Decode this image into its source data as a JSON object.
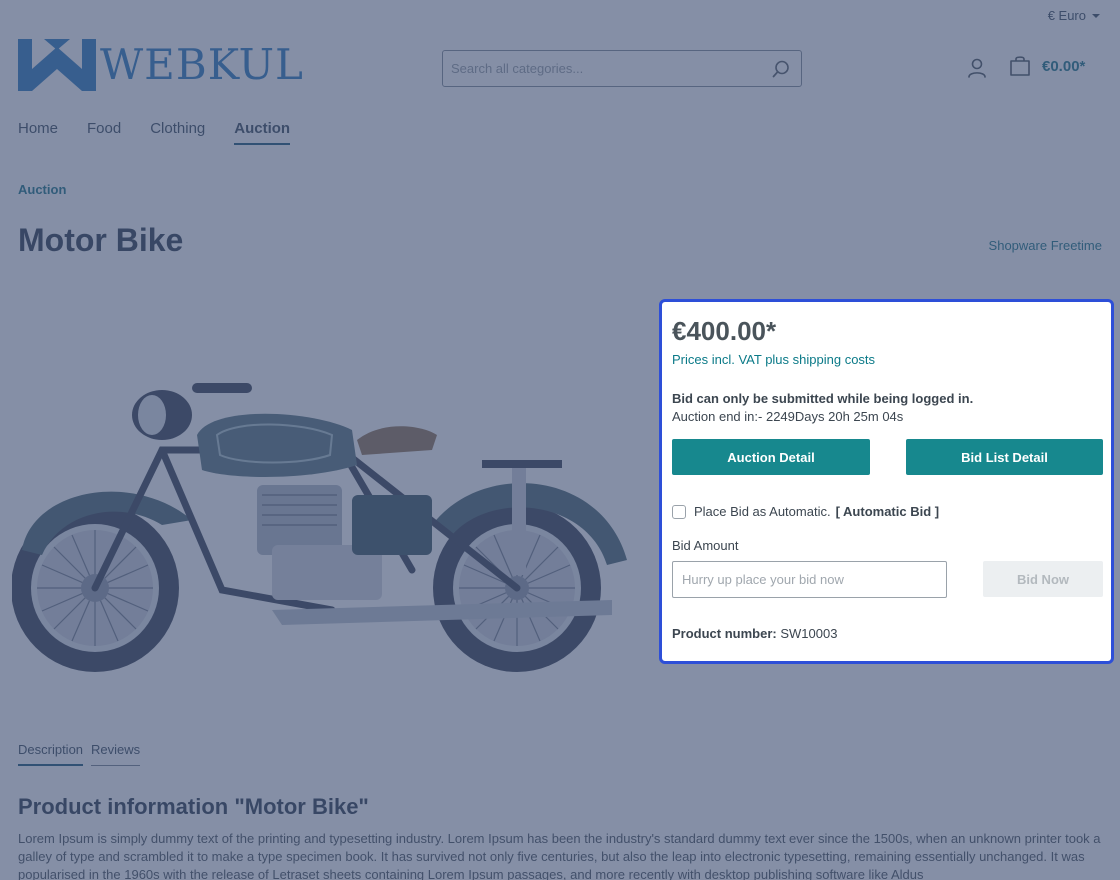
{
  "topbar": {
    "currency": "€ Euro"
  },
  "header": {
    "logo_text": "WEBKUL",
    "search_placeholder": "Search all categories...",
    "cart_total": "€0.00*"
  },
  "nav": {
    "items": [
      {
        "label": "Home"
      },
      {
        "label": "Food"
      },
      {
        "label": "Clothing"
      },
      {
        "label": "Auction"
      }
    ],
    "active": "Auction"
  },
  "breadcrumb": "Auction",
  "product": {
    "title": "Motor Bike",
    "manufacturer": "Shopware Freetime"
  },
  "buybox": {
    "price": "€400.00*",
    "vat_note": "Prices incl. VAT plus shipping costs",
    "login_note": "Bid can only be submitted while being logged in.",
    "end_label": "Auction end in:-",
    "end_value": "2249Days 20h 25m 04s",
    "auction_detail_label": "Auction Detail",
    "bid_list_label": "Bid List Detail",
    "auto_bid_label": "Place Bid as Automatic.",
    "auto_bid_tag": "[ Automatic Bid ]",
    "bid_amount_label": "Bid Amount",
    "bid_input_placeholder": "Hurry up place your bid now",
    "bid_now_label": "Bid Now",
    "product_number_label": "Product number:",
    "product_number_value": "SW10003"
  },
  "tabs": [
    {
      "label": "Description"
    },
    {
      "label": "Reviews"
    }
  ],
  "description": {
    "title": "Product information \"Motor Bike\"",
    "text": "Lorem Ipsum is simply dummy text of the printing and typesetting industry. Lorem Ipsum has been the industry's standard dummy text ever since the 1500s, when an unknown printer took a galley of type and scrambled it to make a type specimen book. It has survived not only five centuries, but also the leap into electronic typesetting, remaining essentially unchanged. It was popularised in the 1960s with the release of Letraset sheets containing Lorem Ipsum passages, and more recently with desktop publishing software like Aldus"
  },
  "colors": {
    "accent": "#17888e",
    "brand": "#1d6fb8",
    "modal_border": "#2d4fd8"
  }
}
